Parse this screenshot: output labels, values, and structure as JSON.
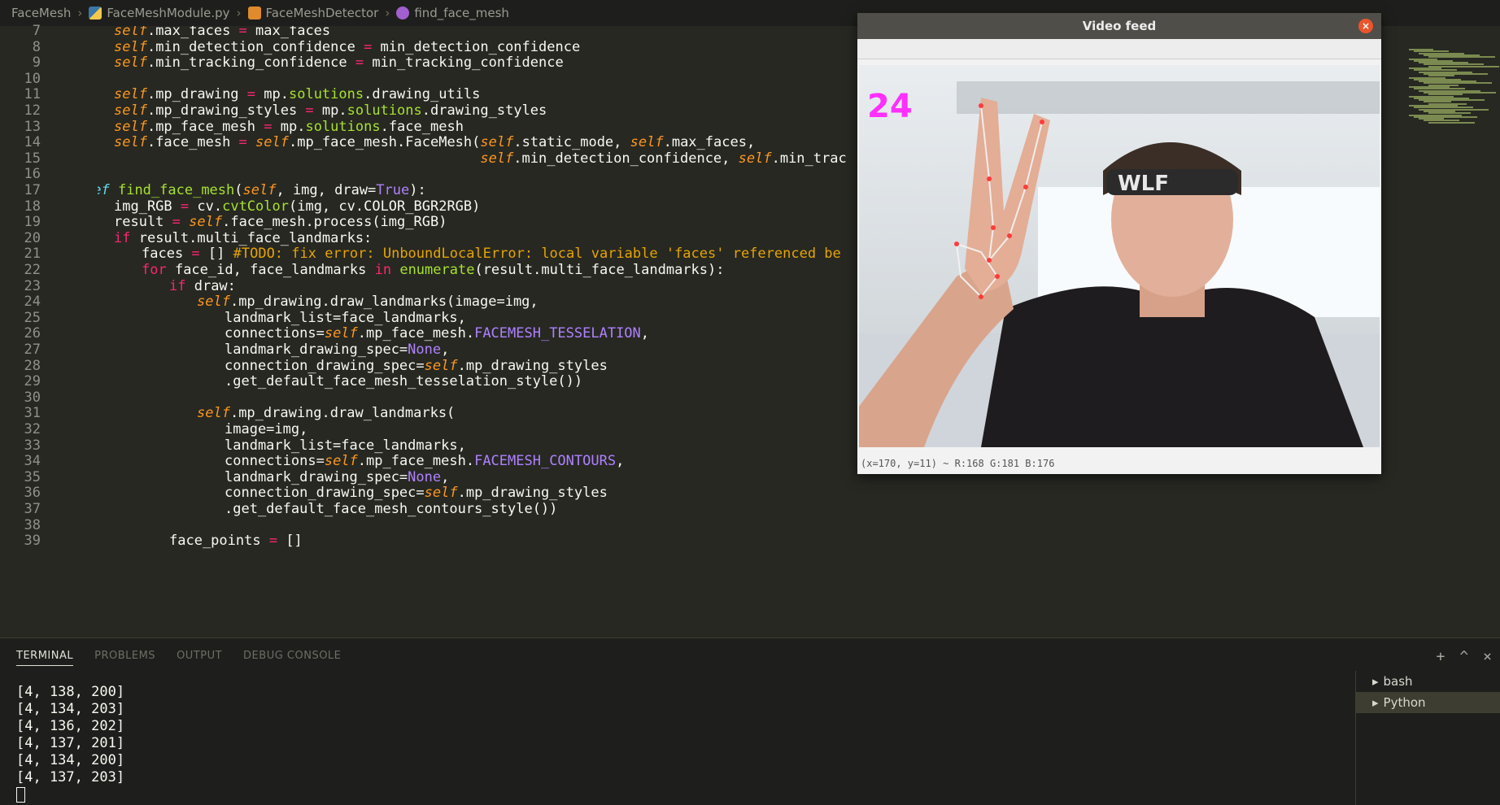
{
  "breadcrumb": [
    {
      "label": "FaceMesh",
      "icon": "folder-icon"
    },
    {
      "label": "FaceMeshModule.py",
      "icon": "python-file-icon"
    },
    {
      "label": "FaceMeshDetector",
      "icon": "class-icon"
    },
    {
      "label": "find_face_mesh",
      "icon": "function-icon"
    }
  ],
  "code_lines": [
    {
      "n": "7",
      "indent": 0,
      "text": "self.max_faces = max_faces"
    },
    {
      "n": "8",
      "indent": 0,
      "text": "self.min_detection_confidence = min_detection_confidence"
    },
    {
      "n": "9",
      "indent": 0,
      "text": "self.min_tracking_confidence = min_tracking_confidence"
    },
    {
      "n": "10",
      "indent": 0,
      "text": ""
    },
    {
      "n": "11",
      "indent": 0,
      "text": "self.mp_drawing = mp.solutions.drawing_utils"
    },
    {
      "n": "12",
      "indent": 0,
      "text": "self.mp_drawing_styles = mp.solutions.drawing_styles"
    },
    {
      "n": "13",
      "indent": 0,
      "text": "self.mp_face_mesh = mp.solutions.face_mesh"
    },
    {
      "n": "14",
      "indent": 0,
      "text": "self.face_mesh = self.mp_face_mesh.FaceMesh(self.static_mode, self.max_faces,"
    },
    {
      "n": "15",
      "indent": 0,
      "text": "                                            self.min_detection_confidence, self.min_trac"
    },
    {
      "n": "16",
      "indent": 0,
      "text": ""
    },
    {
      "n": "17",
      "indent": -1,
      "text": "def find_face_mesh(self, img, draw=True):"
    },
    {
      "n": "18",
      "indent": 0,
      "text": "img_RGB = cv.cvtColor(img, cv.COLOR_BGR2RGB)"
    },
    {
      "n": "19",
      "indent": 0,
      "text": "result = self.face_mesh.process(img_RGB)"
    },
    {
      "n": "20",
      "indent": 0,
      "text": "if result.multi_face_landmarks:"
    },
    {
      "n": "21",
      "indent": 1,
      "text": "faces = [] #TODO: fix error: UnboundLocalError: local variable 'faces' referenced be"
    },
    {
      "n": "22",
      "indent": 1,
      "text": "for face_id, face_landmarks in enumerate(result.multi_face_landmarks):"
    },
    {
      "n": "23",
      "indent": 2,
      "text": "if draw:"
    },
    {
      "n": "24",
      "indent": 3,
      "text": "self.mp_drawing.draw_landmarks(image=img,"
    },
    {
      "n": "25",
      "indent": 4,
      "text": "landmark_list=face_landmarks,"
    },
    {
      "n": "26",
      "indent": 4,
      "text": "connections=self.mp_face_mesh.FACEMESH_TESSELATION,"
    },
    {
      "n": "27",
      "indent": 4,
      "text": "landmark_drawing_spec=None,"
    },
    {
      "n": "28",
      "indent": 4,
      "text": "connection_drawing_spec=self.mp_drawing_styles"
    },
    {
      "n": "29",
      "indent": 4,
      "text": ".get_default_face_mesh_tesselation_style())"
    },
    {
      "n": "30",
      "indent": 0,
      "text": ""
    },
    {
      "n": "31",
      "indent": 3,
      "text": "self.mp_drawing.draw_landmarks("
    },
    {
      "n": "32",
      "indent": 4,
      "text": "image=img,"
    },
    {
      "n": "33",
      "indent": 4,
      "text": "landmark_list=face_landmarks,"
    },
    {
      "n": "34",
      "indent": 4,
      "text": "connections=self.mp_face_mesh.FACEMESH_CONTOURS,"
    },
    {
      "n": "35",
      "indent": 4,
      "text": "landmark_drawing_spec=None,"
    },
    {
      "n": "36",
      "indent": 4,
      "text": "connection_drawing_spec=self.mp_drawing_styles"
    },
    {
      "n": "37",
      "indent": 4,
      "text": ".get_default_face_mesh_contours_style())"
    },
    {
      "n": "38",
      "indent": 0,
      "text": ""
    },
    {
      "n": "39",
      "indent": 2,
      "text": "face_points = []"
    }
  ],
  "panel": {
    "tabs": [
      "TERMINAL",
      "PROBLEMS",
      "OUTPUT",
      "DEBUG CONSOLE"
    ],
    "active_tab": "TERMINAL",
    "terminal_lines": [
      "[4, 138, 200]",
      "[4, 134, 203]",
      "[4, 136, 202]",
      "[4, 137, 201]",
      "[4, 134, 200]",
      "[4, 137, 203]"
    ],
    "terminals": [
      {
        "label": "bash",
        "selected": false
      },
      {
        "label": "Python",
        "selected": true
      }
    ]
  },
  "video_window": {
    "title": "Video feed",
    "fps_overlay": "24",
    "status": "(x=170, y=11) ~ R:168 G:181 B:176"
  },
  "colors": {
    "editor_bg": "#272822",
    "accent_close": "#e9562b",
    "fps_magenta": "#ff2fff"
  }
}
